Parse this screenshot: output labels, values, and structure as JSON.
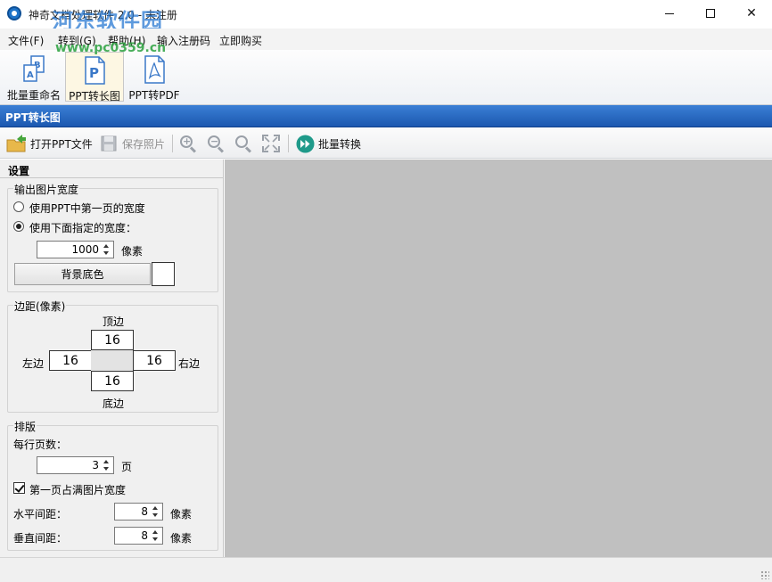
{
  "window": {
    "title": "神奇文档处理软件 2.0 - 未注册",
    "watermark_title": "河东软件园",
    "watermark_url": "www.pc0359.cn"
  },
  "menu": [
    {
      "label": "文件(F)"
    },
    {
      "label": "转到(G)"
    },
    {
      "label": "帮助(H)"
    },
    {
      "label": "输入注册码"
    },
    {
      "label": "立即购买"
    }
  ],
  "ribbon": [
    {
      "label": "批量重命名",
      "icon": "batch-rename-icon"
    },
    {
      "label": "PPT转长图",
      "icon": "ppt-icon",
      "active": true
    },
    {
      "label": "PPT转PDF",
      "icon": "pdf-icon"
    }
  ],
  "page_header": "PPT转长图",
  "toolbar": {
    "open": "打开PPT文件",
    "save": "保存照片",
    "batch": "批量转换"
  },
  "settings": {
    "title": "设置",
    "output_width": {
      "group_label": "输出图片宽度",
      "option_first_page": "使用PPT中第一页的宽度",
      "option_specified": "使用下面指定的宽度：",
      "width_value": "1000",
      "unit": "像素",
      "bg_button": "背景底色",
      "bg_color": "#ffffff"
    },
    "margins": {
      "group_label": "边距(像素)",
      "top_label": "顶边",
      "top_value": "16",
      "left_label": "左边",
      "left_value": "16",
      "right_label": "右边",
      "right_value": "16",
      "bottom_label": "底边",
      "bottom_value": "16"
    },
    "layout": {
      "group_label": "排版",
      "pages_per_row_label": "每行页数：",
      "pages_per_row_value": "3",
      "pages_unit": "页",
      "first_page_full": "第一页占满图片宽度",
      "h_spacing_label": "水平间距：",
      "h_spacing_value": "8",
      "h_unit": "像素",
      "v_spacing_label": "垂直间距：",
      "v_spacing_value": "8",
      "v_unit": "像素"
    }
  },
  "colors": {
    "header_blue": "#1c58b0",
    "canvas_gray": "#c0c0c0"
  }
}
